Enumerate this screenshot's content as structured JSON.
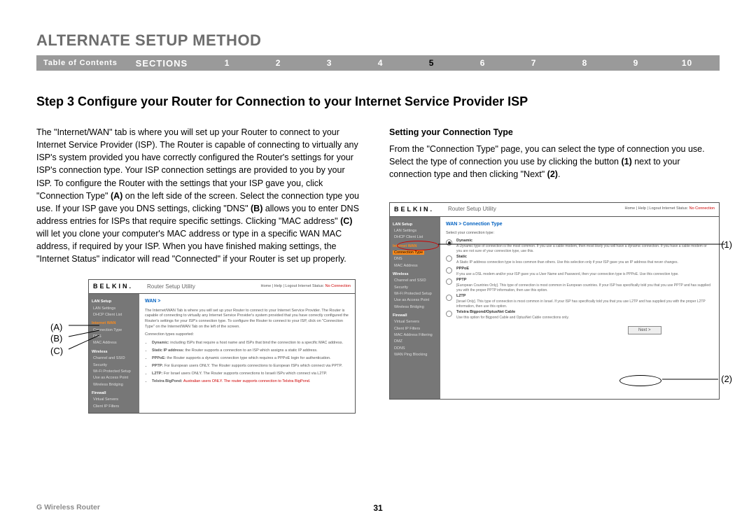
{
  "header": "ALTERNATE SETUP METHOD",
  "nav": {
    "toc": "Table of Contents",
    "sections_label": "SECTIONS",
    "numbers": [
      "1",
      "2",
      "3",
      "4",
      "5",
      "6",
      "7",
      "8",
      "9",
      "10"
    ],
    "active": "5"
  },
  "step_heading": "Step 3 Configure your Router for Connection to your Internet Service Provider ISP",
  "left_para_a": "The \"Internet/WAN\" tab is where you will set up your Router to connect to your Internet Service Provider (ISP). The Router is capable of connecting to virtually any ISP's system provided you have correctly configured the Router's settings for your ISP's connection type. Your ISP connection settings are provided to you by your ISP. To configure the Router with the settings that your ISP gave you, click \"Connection Type\" ",
  "left_label_A": "(A)",
  "left_para_b": " on the left side of the screen. Select the connection type you use. If your ISP gave you DNS settings, clicking \"DNS\" ",
  "left_label_B": "(B)",
  "left_para_c": " allows you to enter DNS address entries for ISPs that require specific settings. Clicking \"MAC address\" ",
  "left_label_C": "(C)",
  "left_para_d": " will let you clone your computer's MAC address or type in a specific WAN MAC address, if required by your ISP. When you have finished making settings, the \"Internet Status\" indicator will read \"Connected\" if your Router is set up properly.",
  "right_heading": "Setting your Connection Type",
  "right_para_a": "From the \"Connection Type\" page, you can select the type of connection you use. Select the type of connection you use by clicking the button ",
  "right_label_1": "(1)",
  "right_para_b": " next to your connection type and then clicking \"Next\" ",
  "right_label_2": "(2)",
  "right_para_c": ".",
  "footer_left": "G Wireless Router",
  "page_number": "31",
  "ss1": {
    "logo": "BELKIN",
    "title": "Router Setup Utility",
    "links_a": "Home | Help | Logout   Internet Status:",
    "links_b": "No Connection",
    "crumb": "WAN >",
    "intro": "The Internet/WAN Tab is where you will set up your Router to connect to your Internet Service Provider. The Router is capable of connecting to virtually any Internet Service Provider's system provided that you have correctly configured the Router's settings for your ISP's connection type. To configure the Router to connect to your ISP, click on \"Connection Type\" on the Internet/WAN Tab on the left of the screen.",
    "supported_label": "Connection types supported:",
    "b_dynamic": "Dynamic:",
    "b_dynamic_t": " including ISPs that require a host name and ISPs that bind the connection to a specific MAC address.",
    "b_static": "Static IP address:",
    "b_static_t": " the Router supports a connection to an ISP which assigns a static IP address.",
    "b_pppoe": "PPPoE:",
    "b_pppoe_t": " the Router supports a dynamic connection type which requires a PPPoE login for authentication.",
    "b_pptp": "PPTP:",
    "b_pptp_t": " For European users ONLY. The Router supports connections to European ISPs which connect via PPTP.",
    "b_l2tp": "L2TP:",
    "b_l2tp_t": " For Israel users ONLY. The Router supports connections to Israeli ISPs which connect via L2TP.",
    "b_telstra": "Telstra BigPond:",
    "b_telstra_t": "Australian users ONLY. The router supports connection to Telstra BigPond.",
    "side": {
      "h_lan": "LAN Setup",
      "lan1": "LAN Settings",
      "lan2": "DHCP Client List",
      "h_wan": "Internet WAN",
      "wan1": "Connection Type",
      "wan2": "DNS",
      "wan3": "MAC Address",
      "h_wl": "Wireless",
      "wl1": "Channel and SSID",
      "wl2": "Security",
      "wl3": "Wi-Fi Protected Setup",
      "wl4": "Use as Access Point",
      "wl5": "Wireless Bridging",
      "h_fw": "Firewall",
      "fw1": "Virtual Servers",
      "fw2": "Client IP Filters"
    }
  },
  "ss2": {
    "logo": "BELKIN",
    "title": "Router Setup Utility",
    "links_a": "Home | Help | Logout   Internet Status:",
    "links_b": "No Connection",
    "crumb": "WAN > Connection Type",
    "select_label": "Select your connection type:",
    "o_dyn": "Dynamic",
    "o_dyn_d": "A Dynamic type of connection is the most common. If you use a cable modem, then most likely you will have a dynamic connection. If you have a cable modem or you are not sure of your connection type, use this.",
    "o_static": "Static",
    "o_static_d": "A Static IP address connection type is less common than others. Use this selection only if your ISP gave you an IP address that never changes.",
    "o_pppoe": "PPPoE",
    "o_pppoe_d": "If you use a DSL modem and/or your ISP gave you a User Name and Password, then your connection type is PPPoE. Use this connection type.",
    "o_pptp": "PPTP",
    "o_pptp_d": "[European Countries Only]. This type of connection is most common in European countries. If your ISP has specifically told you that you use PPTP and has supplied you with the proper PPTP information, then use this option.",
    "o_l2tp": "L2TP",
    "o_l2tp_d": "[Israel Only]. This type of connection is most common in Israel. If your ISP has specifically told you that you use L2TP and has supplied you with the proper L2TP information, then use this option.",
    "o_tel": "Telstra Bigpond/OptusNet Cable",
    "o_tel_d": "Use this option for Bigpond Cable and OptusNet Cable connections only.",
    "next": "Next >",
    "side": {
      "h_lan": "LAN Setup",
      "lan1": "LAN Settings",
      "lan2": "DHCP Client List",
      "h_wan": "Internet WAN",
      "wan1": "Connection Type",
      "wan2": "DNS",
      "wan3": "MAC Address",
      "h_wl": "Wireless",
      "wl1": "Channel and SSID",
      "wl2": "Security",
      "wl3": "Wi-Fi Protected Setup",
      "wl4": "Use as Access Point",
      "wl5": "Wireless Bridging",
      "h_fw": "Firewall",
      "fw1": "Virtual Servers",
      "fw2": "Client IP Filters",
      "fw3": "MAC Address Filtering",
      "fw4": "DMZ",
      "fw5": "DDNS",
      "fw6": "WAN Ping Blocking"
    }
  },
  "callout": {
    "A": "(A)",
    "B": "(B)",
    "C": "(C)",
    "one": "(1)",
    "two": "(2)"
  }
}
